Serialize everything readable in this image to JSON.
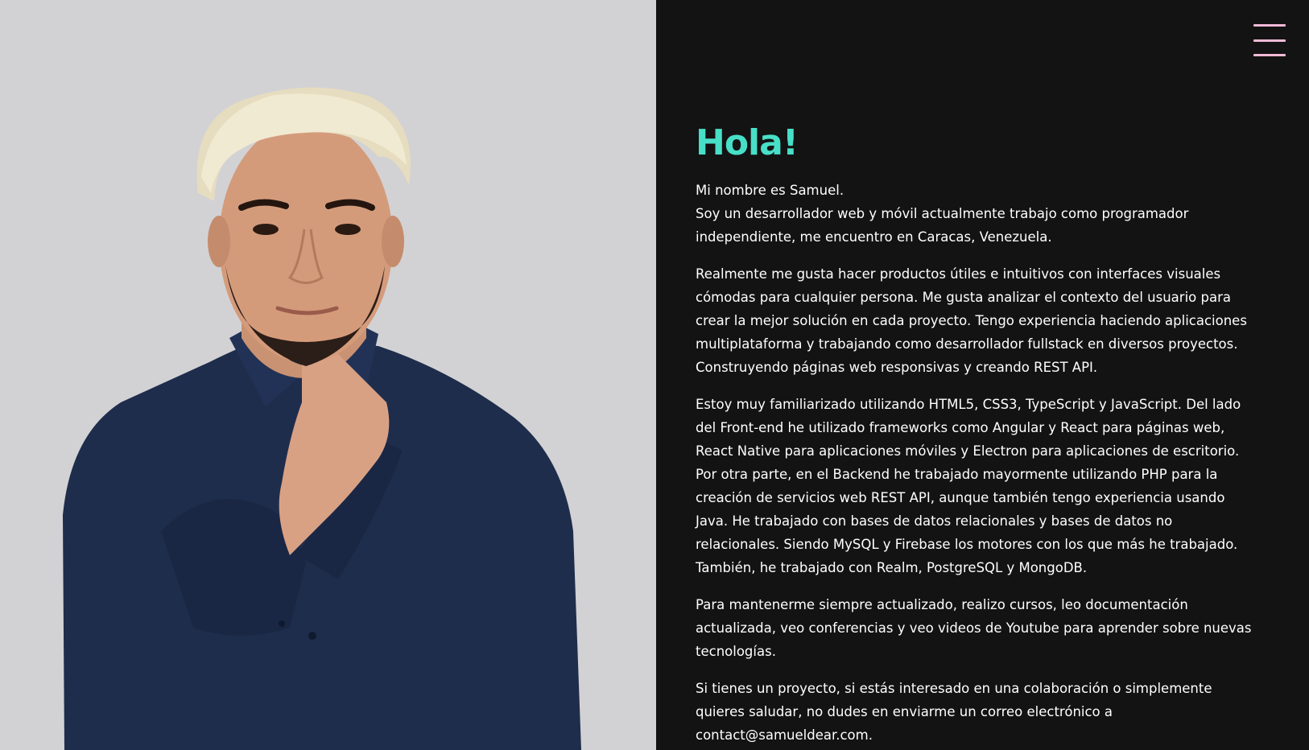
{
  "colors": {
    "accent": "#48dfc8",
    "menu": "#f2b9d6",
    "background_dark": "#131313",
    "photo_background": "#d2d2d4",
    "text": "#ffffff"
  },
  "header": {
    "menu_icon": "hamburger-menu-icon"
  },
  "profile": {
    "photo_alt": "portrait-photo"
  },
  "about": {
    "greeting": "Hola!",
    "paragraphs": [
      [
        "Mi nombre es Samuel.",
        "Soy un desarrollador web y móvil actualmente trabajo como programador",
        "independiente, me encuentro en Caracas, Venezuela."
      ],
      [
        "Realmente me gusta hacer productos útiles e intuitivos con interfaces visuales",
        "cómodas para cualquier persona. Me gusta analizar el contexto del usuario para",
        "crear la mejor solución en cada proyecto. Tengo experiencia haciendo aplicaciones",
        "multiplataforma y trabajando como desarrollador fullstack en diversos proyectos.",
        "Construyendo páginas web responsivas y creando REST API."
      ],
      [
        "Estoy muy familiarizado utilizando HTML5, CSS3, TypeScript y JavaScript. Del lado",
        "del Front-end he utilizado frameworks como Angular y React para páginas web,",
        "React Native para aplicaciones móviles y Electron para aplicaciones de escritorio.",
        "Por otra parte, en el Backend he trabajado mayormente utilizando PHP para la",
        "creación de servicios web REST API, aunque también tengo experiencia usando",
        "Java. He trabajado con bases de datos relacionales y bases de datos no",
        "relacionales. Siendo MySQL y Firebase los motores con los que más he trabajado.",
        "También, he trabajado con Realm, PostgreSQL y MongoDB."
      ],
      [
        "Para mantenerme siempre actualizado, realizo cursos, leo documentación",
        "actualizada, veo conferencias y veo videos de Youtube para aprender sobre nuevas",
        "tecnologías."
      ],
      [
        "Si tienes un proyecto, si estás interesado en una colaboración o simplemente",
        "quieres saludar, no dudes en enviarme un correo electrónico a",
        "contact@samueldear.com."
      ]
    ]
  }
}
